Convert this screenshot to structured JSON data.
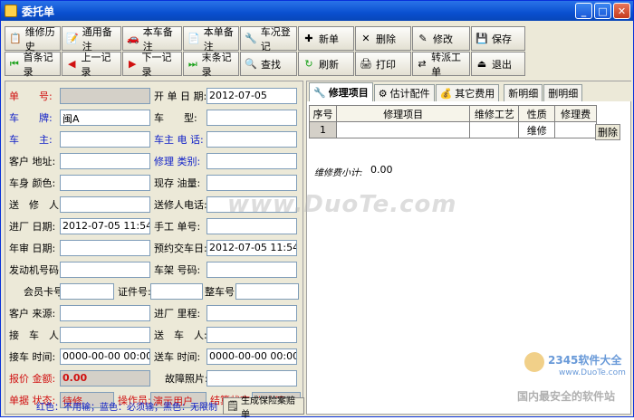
{
  "window": {
    "title": "委托单"
  },
  "toolbar_row1": [
    {
      "label": "维修历史",
      "icon": "📋"
    },
    {
      "label": "通用备注",
      "icon": "📝"
    },
    {
      "label": "本车备注",
      "icon": "🚗"
    },
    {
      "label": "本单备注",
      "icon": "📄"
    },
    {
      "label": "车况登记",
      "icon": "🔧"
    },
    {
      "label": "新单",
      "icon": "✚"
    },
    {
      "label": "删除",
      "icon": "✕"
    },
    {
      "label": "修改",
      "icon": "✎"
    },
    {
      "label": "保存",
      "icon": "💾"
    }
  ],
  "toolbar_row2": [
    {
      "label": "首条记录",
      "icon": "⏮"
    },
    {
      "label": "上一记录",
      "icon": "◀"
    },
    {
      "label": "下一记录",
      "icon": "▶"
    },
    {
      "label": "末条记录",
      "icon": "⏭"
    },
    {
      "label": "查找",
      "icon": "🔍"
    },
    {
      "label": "刷新",
      "icon": "↻"
    },
    {
      "label": "打印",
      "icon": "🖨"
    },
    {
      "label": "转派工单",
      "icon": "⇄"
    },
    {
      "label": "退出",
      "icon": "⏏"
    }
  ],
  "form": {
    "order_no_label": "单　　号:",
    "order_no": "",
    "entry_date_label": "开 单 日 期:",
    "entry_date": "2012-07-05",
    "plate_label": "车　　牌:",
    "plate": "闽A",
    "model_label": "车　　型:",
    "model": "",
    "owner_label": "车　　主:",
    "owner": "",
    "owner_phone_label": "车主 电 话:",
    "owner_phone": "",
    "address_label": "客户 地址:",
    "address": "",
    "repair_type_label": "修理 类别:",
    "repair_type": "",
    "color_label": "车身 颜色:",
    "color": "",
    "fuel_label": "现存 油量:",
    "fuel": "",
    "sender_label": "送　修　人:",
    "sender": "",
    "sender_phone_label": "送修人电话:",
    "sender_phone": "",
    "in_date_label": "进厂 日期:",
    "in_date": "2012-07-05 11:54",
    "manual_no_label": "手工 单号:",
    "manual_no": "",
    "inspect_date_label": "年审 日期:",
    "inspect_date": "",
    "pickup_date_label": "预约交车日:",
    "pickup_date": "2012-07-05 11:54",
    "engine_label": "发动机号码:",
    "engine": "",
    "vin_label": "车架 号码:",
    "vin": "",
    "member_label": "会员卡号:",
    "member": "",
    "id_label": "证件号:",
    "id_no": "",
    "whole_no_label": "整车号:",
    "whole_no": "",
    "source_label": "客户 来源:",
    "source": "",
    "mileage_label": "进厂 里程:",
    "mileage": "",
    "receiver_label": "接　车　人:",
    "receiver": "",
    "deliverer_label": "送　车　人:",
    "deliverer": "",
    "receive_time_label": "接车 时间:",
    "receive_time": "0000-00-00 00:00",
    "deliver_time_label": "送车 时间:",
    "deliver_time": "0000-00-00 00:00",
    "quote_label": "报价 金额:",
    "quote": "0.00",
    "photo_label": "故障照片:",
    "photo": "",
    "status_label": "单据 状态:",
    "status": "待修",
    "operator_label": "操作员:",
    "operator": "演示用户",
    "settle_label": "结算状态:",
    "settle": "未结算",
    "legend": "红色：不用输；蓝色：必须输；黑色：无限制",
    "gen_button": "生成保险案赔单"
  },
  "tabs": [
    {
      "label": "修理项目",
      "active": true
    },
    {
      "label": "估计配件",
      "active": false
    },
    {
      "label": "其它费用",
      "active": false
    },
    {
      "label": "新明细",
      "active": false
    },
    {
      "label": "删明细",
      "active": false
    }
  ],
  "grid": {
    "headers": [
      "序号",
      "修理项目",
      "维修工艺",
      "性质",
      "修理费"
    ],
    "rows": [
      {
        "no": "1",
        "item": "",
        "craft": "",
        "nature": "维修",
        "fee": ""
      }
    ],
    "delete_label": "删除"
  },
  "subtotal": {
    "label": "维修费小计:",
    "value": "0.00"
  },
  "watermark": "www.DuoTe.com",
  "logo": {
    "brand": "2345软件大全",
    "url": "www.DuoTe.com",
    "slogan": "国内最安全的软件站"
  }
}
